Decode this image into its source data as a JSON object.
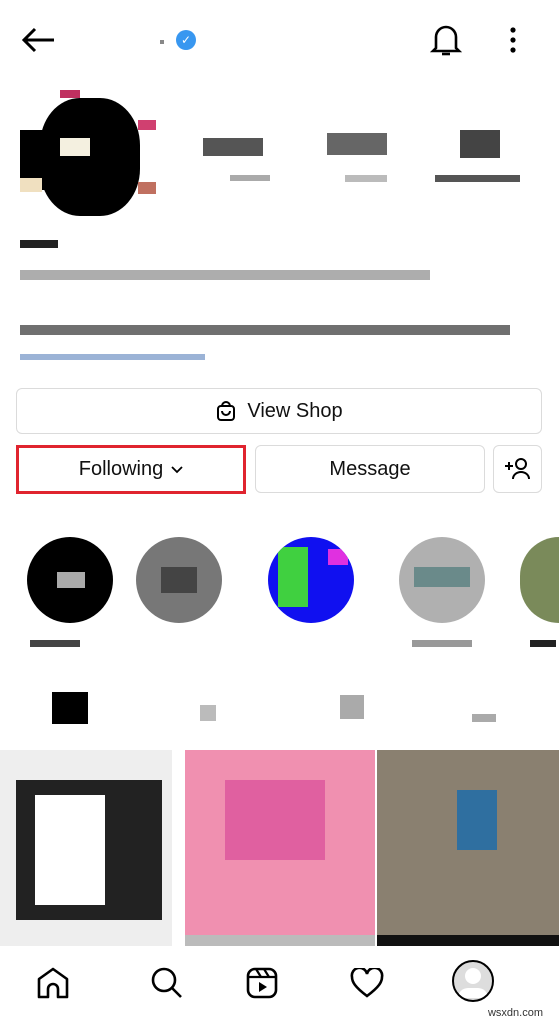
{
  "header": {
    "back_icon": "arrow-left-icon",
    "verified_icon": "verified-badge-icon",
    "verified_color": "#3897f0",
    "notification_icon": "bell-icon",
    "more_icon": "vertical-dots-icon"
  },
  "profile": {
    "avatar": "pixelated-avatar"
  },
  "buttons": {
    "view_shop": "View Shop",
    "shop_icon": "shopping-bag-icon",
    "following": "Following",
    "following_chevron": "chevron-down-icon",
    "message": "Message",
    "add_person_icon": "add-person-icon",
    "highlight_color": "#e0242f"
  },
  "bottom_nav": {
    "items": [
      "home-icon",
      "search-icon",
      "reels-icon",
      "heart-icon",
      "profile-avatar"
    ]
  },
  "watermark": "wsxdn.com"
}
